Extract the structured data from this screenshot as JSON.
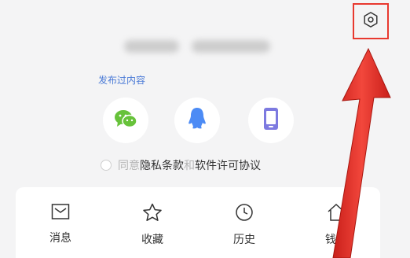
{
  "profile": {
    "published_link": "发布过内容"
  },
  "login_options": [
    {
      "icon": "wechat-icon",
      "color": "#67c23a"
    },
    {
      "icon": "qq-icon",
      "color": "#4c8bf5"
    },
    {
      "icon": "phone-icon",
      "color": "#7d7ae0"
    }
  ],
  "agreement": {
    "prefix": "同意",
    "privacy": "隐私条款",
    "and": "和",
    "license": "软件许可协议"
  },
  "nav": {
    "messages": "消息",
    "favorites": "收藏",
    "history": "历史",
    "fourth": "钱费"
  },
  "colors": {
    "accent_link": "#4a7ad6",
    "highlight": "#e8392f",
    "background": "#f4f4f5"
  }
}
